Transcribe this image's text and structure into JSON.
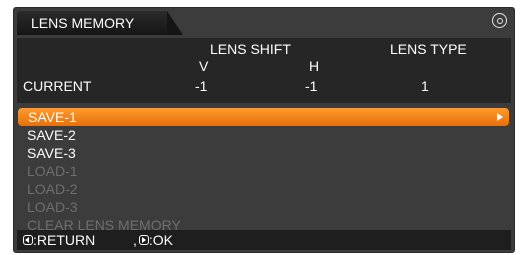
{
  "title": "LENS MEMORY",
  "header_icon": "settings-target-icon",
  "info": {
    "lens_shift_label": "LENS SHIFT",
    "lens_type_label": "LENS TYPE",
    "v_label": "V",
    "h_label": "H",
    "current_label": "CURRENT",
    "current_v": "-1",
    "current_h": "-1",
    "current_lens_type": "1"
  },
  "menu": {
    "items": [
      {
        "label": "SAVE-1",
        "selected": true,
        "enabled": true
      },
      {
        "label": "SAVE-2",
        "selected": false,
        "enabled": true
      },
      {
        "label": "SAVE-3",
        "selected": false,
        "enabled": true
      },
      {
        "label": "LOAD-1",
        "selected": false,
        "enabled": false
      },
      {
        "label": "LOAD-2",
        "selected": false,
        "enabled": false
      },
      {
        "label": "LOAD-3",
        "selected": false,
        "enabled": false
      },
      {
        "label": "CLEAR LENS MEMORY",
        "selected": false,
        "enabled": false
      }
    ]
  },
  "footer": {
    "return_label": ":RETURN",
    "ok_separator": ",",
    "ok_label": ":OK"
  },
  "colors": {
    "panel_bg": "#3c3c3c",
    "info_bg": "#262626",
    "highlight": "#f08a1c",
    "disabled_text": "#6e6e6e"
  }
}
